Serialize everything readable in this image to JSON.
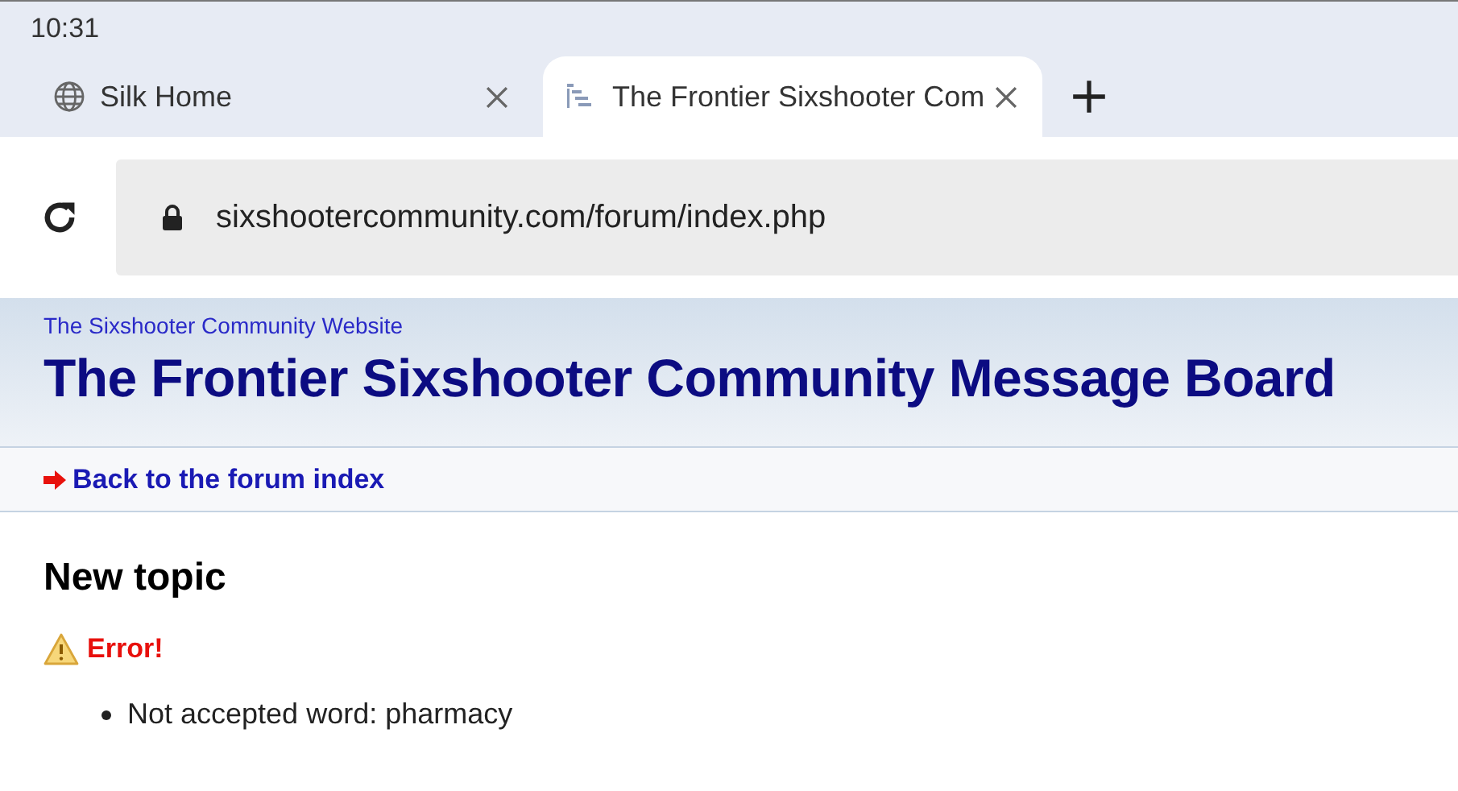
{
  "status_bar": {
    "time": "10:31"
  },
  "tabs": [
    {
      "title": "Silk Home",
      "selected": false
    },
    {
      "title": "The Frontier Sixshooter Com",
      "selected": true
    }
  ],
  "address_bar": {
    "url": "sixshootercommunity.com/forum/index.php"
  },
  "header": {
    "site_link": "The Sixshooter Community Website",
    "title": "The Frontier Sixshooter Community Message Board"
  },
  "nav": {
    "back_link": "Back to the forum index"
  },
  "content": {
    "heading": "New topic",
    "error_title": "Error!",
    "errors": [
      "Not accepted word: pharmacy"
    ]
  }
}
